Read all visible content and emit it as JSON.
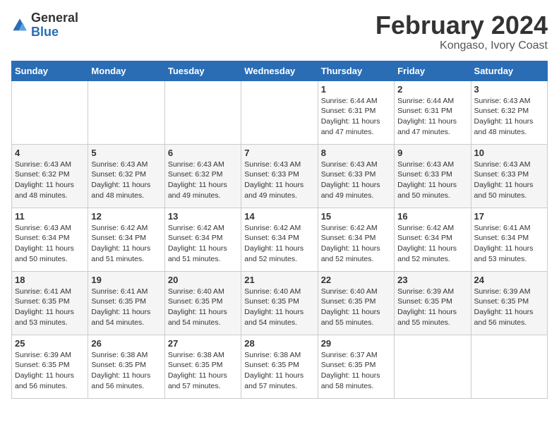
{
  "header": {
    "logo_general": "General",
    "logo_blue": "Blue",
    "month_title": "February 2024",
    "location": "Kongaso, Ivory Coast"
  },
  "weekdays": [
    "Sunday",
    "Monday",
    "Tuesday",
    "Wednesday",
    "Thursday",
    "Friday",
    "Saturday"
  ],
  "weeks": [
    [
      {
        "day": "",
        "info": ""
      },
      {
        "day": "",
        "info": ""
      },
      {
        "day": "",
        "info": ""
      },
      {
        "day": "",
        "info": ""
      },
      {
        "day": "1",
        "info": "Sunrise: 6:44 AM\nSunset: 6:31 PM\nDaylight: 11 hours and 47 minutes."
      },
      {
        "day": "2",
        "info": "Sunrise: 6:44 AM\nSunset: 6:31 PM\nDaylight: 11 hours and 47 minutes."
      },
      {
        "day": "3",
        "info": "Sunrise: 6:43 AM\nSunset: 6:32 PM\nDaylight: 11 hours and 48 minutes."
      }
    ],
    [
      {
        "day": "4",
        "info": "Sunrise: 6:43 AM\nSunset: 6:32 PM\nDaylight: 11 hours and 48 minutes."
      },
      {
        "day": "5",
        "info": "Sunrise: 6:43 AM\nSunset: 6:32 PM\nDaylight: 11 hours and 48 minutes."
      },
      {
        "day": "6",
        "info": "Sunrise: 6:43 AM\nSunset: 6:32 PM\nDaylight: 11 hours and 49 minutes."
      },
      {
        "day": "7",
        "info": "Sunrise: 6:43 AM\nSunset: 6:33 PM\nDaylight: 11 hours and 49 minutes."
      },
      {
        "day": "8",
        "info": "Sunrise: 6:43 AM\nSunset: 6:33 PM\nDaylight: 11 hours and 49 minutes."
      },
      {
        "day": "9",
        "info": "Sunrise: 6:43 AM\nSunset: 6:33 PM\nDaylight: 11 hours and 50 minutes."
      },
      {
        "day": "10",
        "info": "Sunrise: 6:43 AM\nSunset: 6:33 PM\nDaylight: 11 hours and 50 minutes."
      }
    ],
    [
      {
        "day": "11",
        "info": "Sunrise: 6:43 AM\nSunset: 6:34 PM\nDaylight: 11 hours and 50 minutes."
      },
      {
        "day": "12",
        "info": "Sunrise: 6:42 AM\nSunset: 6:34 PM\nDaylight: 11 hours and 51 minutes."
      },
      {
        "day": "13",
        "info": "Sunrise: 6:42 AM\nSunset: 6:34 PM\nDaylight: 11 hours and 51 minutes."
      },
      {
        "day": "14",
        "info": "Sunrise: 6:42 AM\nSunset: 6:34 PM\nDaylight: 11 hours and 52 minutes."
      },
      {
        "day": "15",
        "info": "Sunrise: 6:42 AM\nSunset: 6:34 PM\nDaylight: 11 hours and 52 minutes."
      },
      {
        "day": "16",
        "info": "Sunrise: 6:42 AM\nSunset: 6:34 PM\nDaylight: 11 hours and 52 minutes."
      },
      {
        "day": "17",
        "info": "Sunrise: 6:41 AM\nSunset: 6:34 PM\nDaylight: 11 hours and 53 minutes."
      }
    ],
    [
      {
        "day": "18",
        "info": "Sunrise: 6:41 AM\nSunset: 6:35 PM\nDaylight: 11 hours and 53 minutes."
      },
      {
        "day": "19",
        "info": "Sunrise: 6:41 AM\nSunset: 6:35 PM\nDaylight: 11 hours and 54 minutes."
      },
      {
        "day": "20",
        "info": "Sunrise: 6:40 AM\nSunset: 6:35 PM\nDaylight: 11 hours and 54 minutes."
      },
      {
        "day": "21",
        "info": "Sunrise: 6:40 AM\nSunset: 6:35 PM\nDaylight: 11 hours and 54 minutes."
      },
      {
        "day": "22",
        "info": "Sunrise: 6:40 AM\nSunset: 6:35 PM\nDaylight: 11 hours and 55 minutes."
      },
      {
        "day": "23",
        "info": "Sunrise: 6:39 AM\nSunset: 6:35 PM\nDaylight: 11 hours and 55 minutes."
      },
      {
        "day": "24",
        "info": "Sunrise: 6:39 AM\nSunset: 6:35 PM\nDaylight: 11 hours and 56 minutes."
      }
    ],
    [
      {
        "day": "25",
        "info": "Sunrise: 6:39 AM\nSunset: 6:35 PM\nDaylight: 11 hours and 56 minutes."
      },
      {
        "day": "26",
        "info": "Sunrise: 6:38 AM\nSunset: 6:35 PM\nDaylight: 11 hours and 56 minutes."
      },
      {
        "day": "27",
        "info": "Sunrise: 6:38 AM\nSunset: 6:35 PM\nDaylight: 11 hours and 57 minutes."
      },
      {
        "day": "28",
        "info": "Sunrise: 6:38 AM\nSunset: 6:35 PM\nDaylight: 11 hours and 57 minutes."
      },
      {
        "day": "29",
        "info": "Sunrise: 6:37 AM\nSunset: 6:35 PM\nDaylight: 11 hours and 58 minutes."
      },
      {
        "day": "",
        "info": ""
      },
      {
        "day": "",
        "info": ""
      }
    ]
  ]
}
